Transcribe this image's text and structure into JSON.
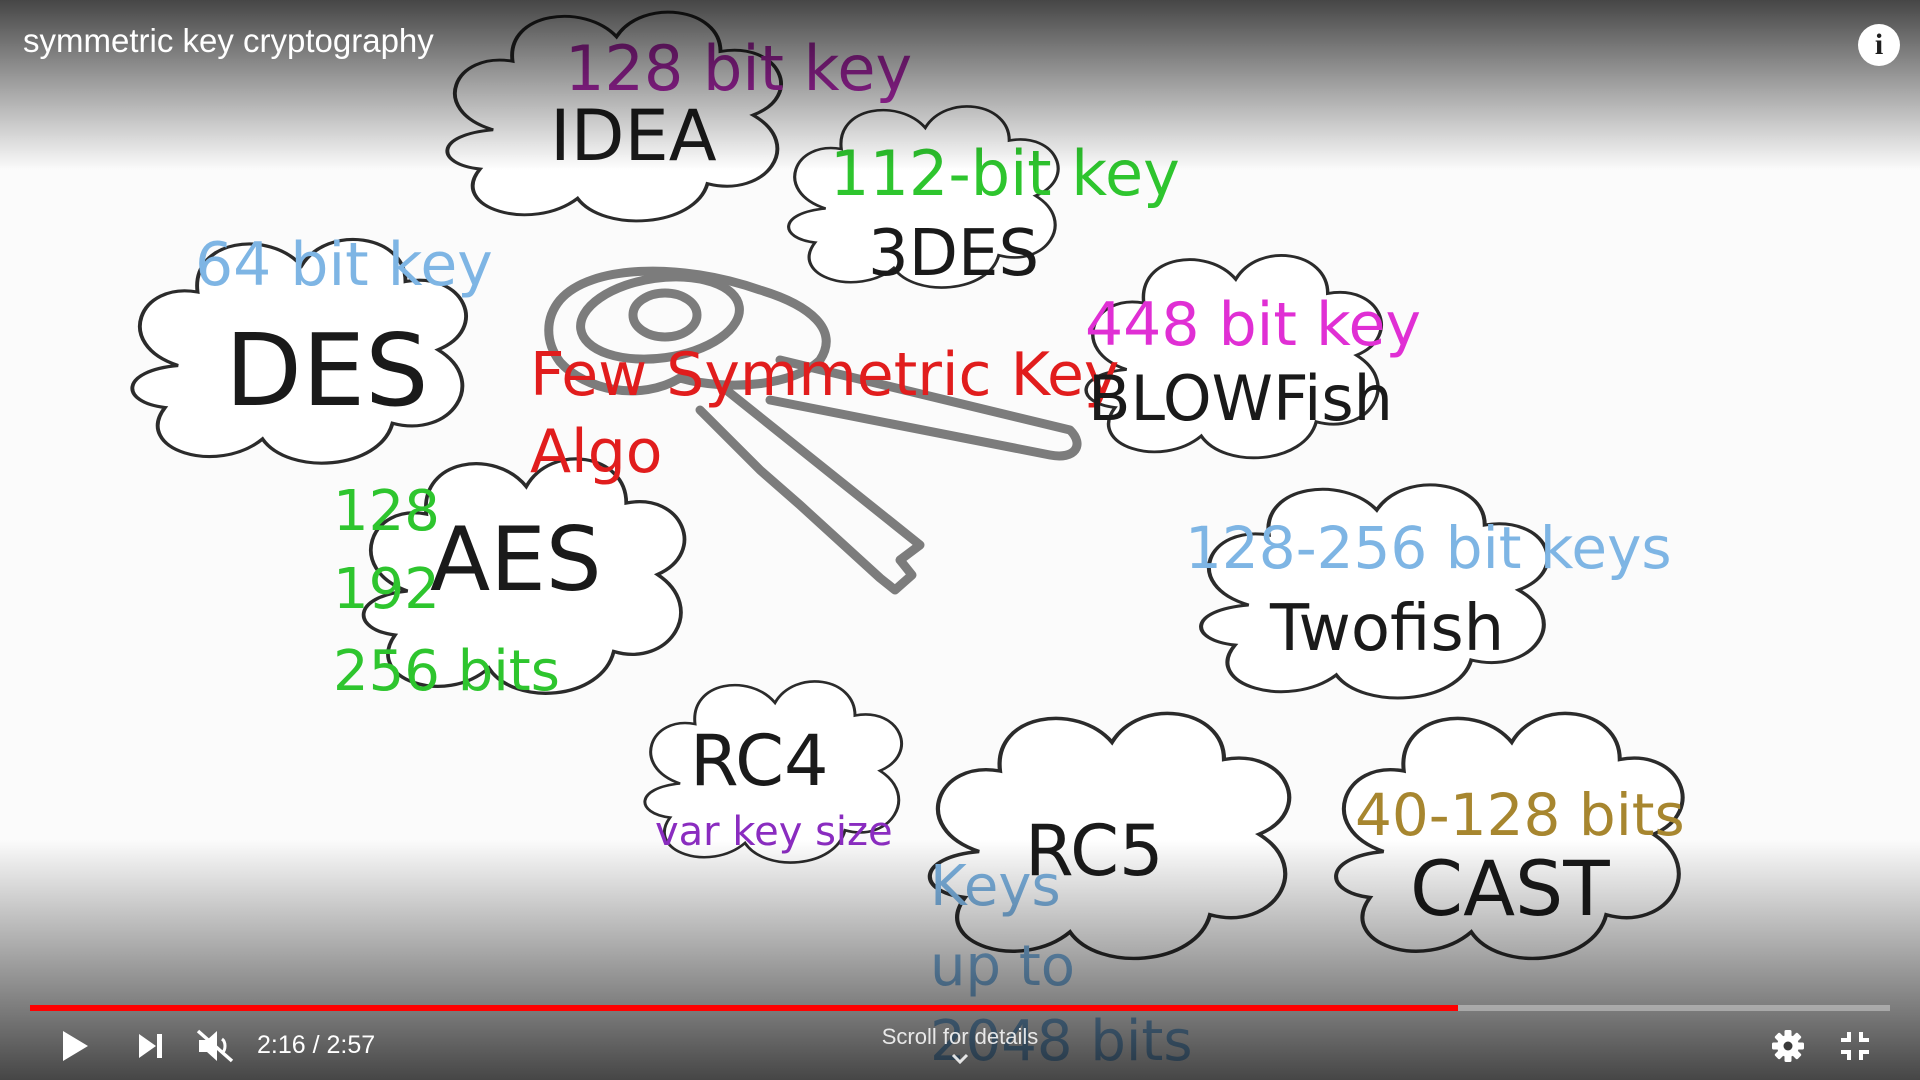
{
  "video": {
    "title": "symmetric key cryptography",
    "center_label": [
      "Few Symmetric Key",
      "Algo"
    ],
    "algorithms": [
      {
        "name": "IDEA",
        "note": "128 bit key"
      },
      {
        "name": "3DES",
        "note": "112-bit key"
      },
      {
        "name": "DES",
        "note": "64 bit key"
      },
      {
        "name": "BLOWFish",
        "note": "448 bit key"
      },
      {
        "name": "AES",
        "note_lines": [
          "128",
          "192",
          "256 bits"
        ]
      },
      {
        "name": "Twofish",
        "note": "128-256 bit keys"
      },
      {
        "name": "RC4",
        "note": "var key size"
      },
      {
        "name": "RC5",
        "note_lines": [
          "Keys",
          "up to",
          "2048 bits"
        ]
      },
      {
        "name": "CAST",
        "note": "40-128 bits"
      }
    ]
  },
  "player": {
    "current_time": "2:16",
    "duration": "2:57",
    "time_display": "2:16 / 2:57",
    "progress_fraction": 0.768,
    "scroll_hint": "Scroll for details",
    "muted": true,
    "icons": {
      "info": "info-icon",
      "play": "play-icon",
      "next": "next-icon",
      "volume": "volume-muted-icon",
      "settings": "gear-icon",
      "fullscreen": "exit-fullscreen-icon",
      "scroll": "chevron-down-icon"
    },
    "colors": {
      "progress": "#ff0000",
      "controls": "#ffffff"
    }
  }
}
